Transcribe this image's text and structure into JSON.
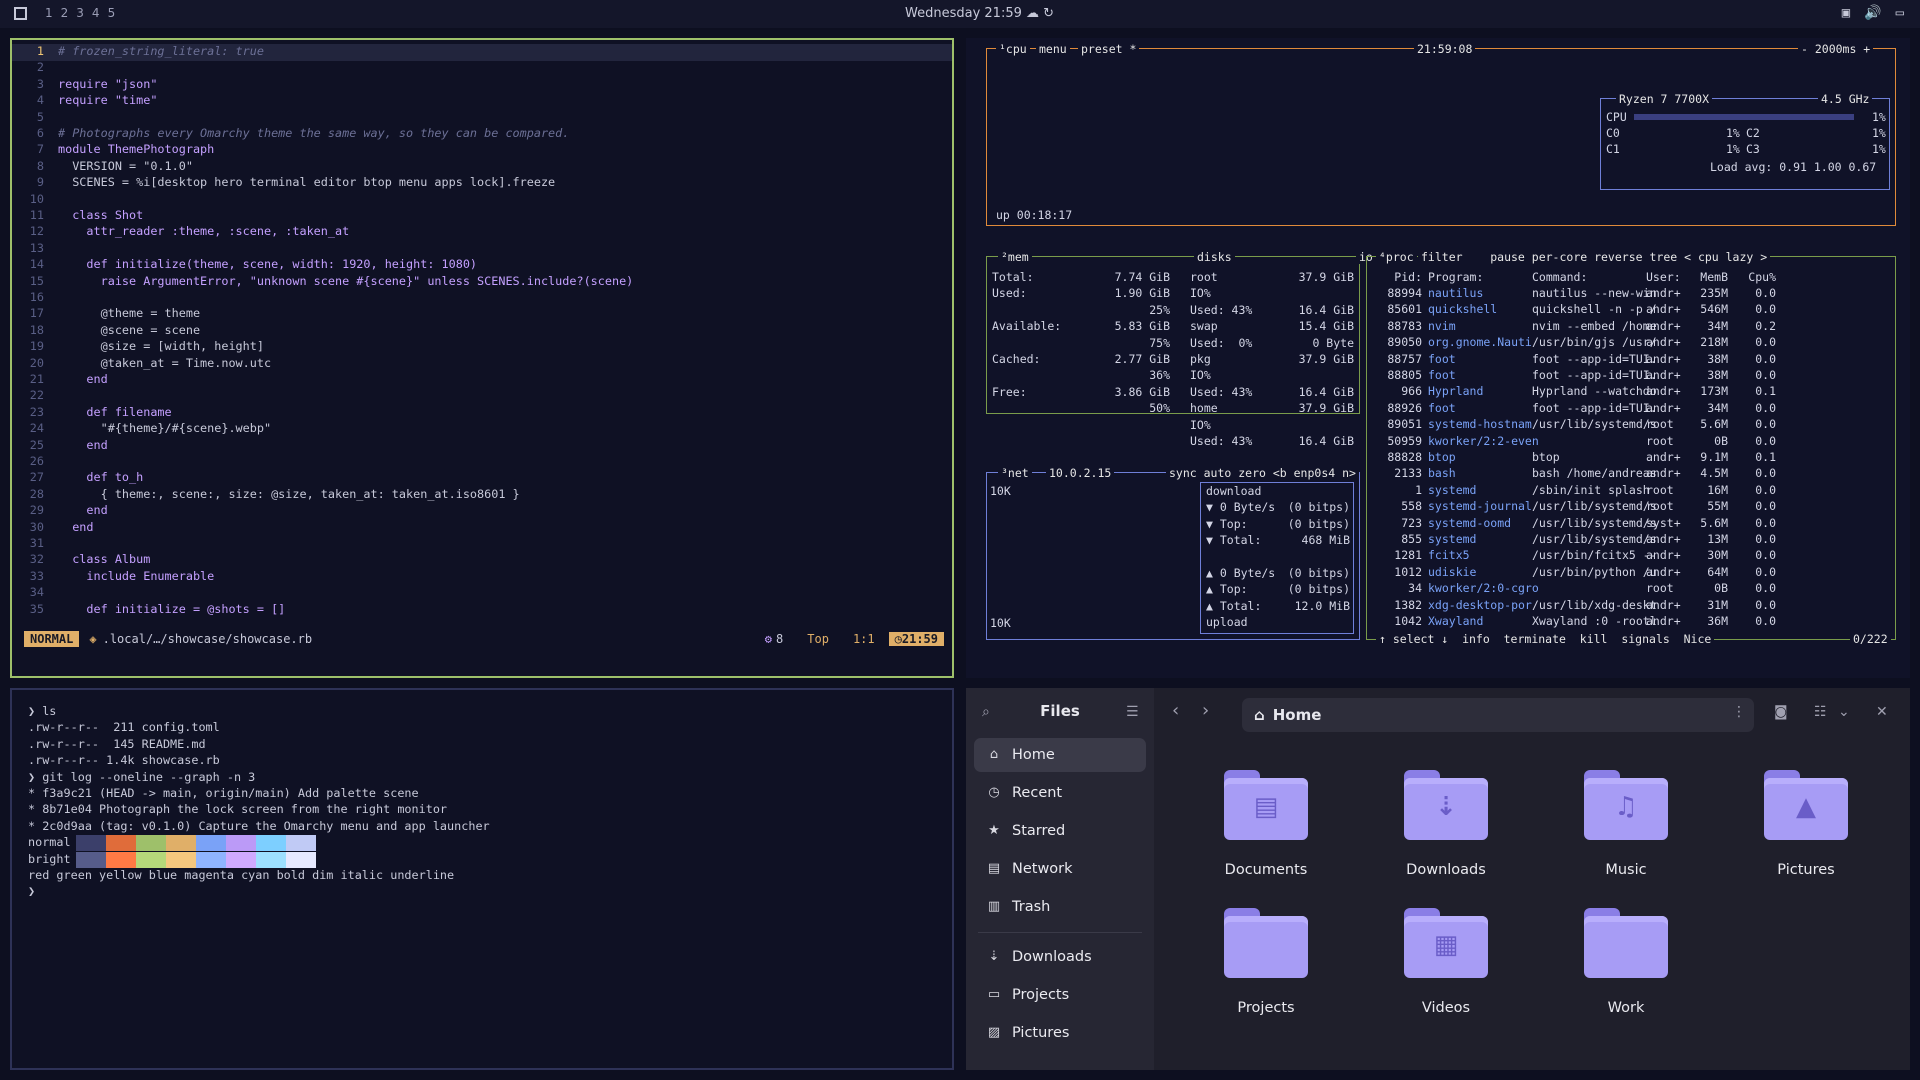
{
  "topbar": {
    "workspaces": [
      "1",
      "2",
      "3",
      "4",
      "5"
    ],
    "clock": "Wednesday 21:59",
    "icons": [
      "cloud-sync-icon",
      "refresh-icon"
    ],
    "tray": [
      "screen-icon",
      "volume-icon",
      "display-icon"
    ]
  },
  "nvim": {
    "lines": [
      [
        "1",
        "# frozen_string_literal: true"
      ],
      [
        "2",
        ""
      ],
      [
        "3",
        "require \"json\""
      ],
      [
        "4",
        "require \"time\""
      ],
      [
        "5",
        ""
      ],
      [
        "6",
        "# Photographs every Omarchy theme the same way, so they can be compared."
      ],
      [
        "7",
        "module ThemePhotograph"
      ],
      [
        "8",
        "  VERSION = \"0.1.0\""
      ],
      [
        "9",
        "  SCENES = %i[desktop hero terminal editor btop menu apps lock].freeze"
      ],
      [
        "10",
        ""
      ],
      [
        "11",
        "  class Shot"
      ],
      [
        "12",
        "    attr_reader :theme, :scene, :taken_at"
      ],
      [
        "13",
        ""
      ],
      [
        "14",
        "    def initialize(theme, scene, width: 1920, height: 1080)"
      ],
      [
        "15",
        "      raise ArgumentError, \"unknown scene #{scene}\" unless SCENES.include?(scene)"
      ],
      [
        "16",
        ""
      ],
      [
        "17",
        "      @theme = theme"
      ],
      [
        "18",
        "      @scene = scene"
      ],
      [
        "19",
        "      @size = [width, height]"
      ],
      [
        "20",
        "      @taken_at = Time.now.utc"
      ],
      [
        "21",
        "    end"
      ],
      [
        "22",
        ""
      ],
      [
        "23",
        "    def filename"
      ],
      [
        "24",
        "      \"#{theme}/#{scene}.webp\""
      ],
      [
        "25",
        "    end"
      ],
      [
        "26",
        ""
      ],
      [
        "27",
        "    def to_h"
      ],
      [
        "28",
        "      { theme:, scene:, size: @size, taken_at: taken_at.iso8601 }"
      ],
      [
        "29",
        "    end"
      ],
      [
        "30",
        "  end"
      ],
      [
        "31",
        ""
      ],
      [
        "32",
        "  class Album"
      ],
      [
        "33",
        "    include Enumerable"
      ],
      [
        "34",
        ""
      ],
      [
        "35",
        "    def initialize = @shots = []"
      ]
    ],
    "status": {
      "mode": "NORMAL",
      "file": ".local/…/showcase/showcase.rb",
      "lsp": "8",
      "pos": "Top",
      "cursor": "1:1",
      "time": "21:59"
    }
  },
  "btop": {
    "cpu": {
      "label": "¹cpu",
      "menu": "menu",
      "preset": "preset *",
      "time": "21:59:08",
      "interval": "- 2000ms +",
      "uptime": "up 00:18:17",
      "model": "Ryzen 7 7700X",
      "freq": "4.5 GHz",
      "rows": [
        "CPU",
        "C0",
        "C1"
      ],
      "rows2": [
        "C2",
        "C3"
      ],
      "pct": "1%",
      "load": "Load avg: 0.91 1.00 0.67"
    },
    "mem": {
      "label": "²mem",
      "rows": [
        [
          "Total:",
          "7.74 GiB"
        ],
        [
          "Used:",
          "1.90 GiB"
        ],
        [
          "",
          "25%"
        ],
        [
          "Available:",
          "5.83 GiB"
        ],
        [
          "",
          "75%"
        ],
        [
          "Cached:",
          "2.77 GiB"
        ],
        [
          "",
          "36%"
        ],
        [
          "Free:",
          "3.86 GiB"
        ],
        [
          "",
          "50%"
        ]
      ]
    },
    "disks": {
      "label": "disks",
      "io": "io",
      "rows": [
        [
          "root",
          "37.9 GiB"
        ],
        [
          "IO%",
          ""
        ],
        [
          "Used: 43%",
          "16.4 GiB"
        ],
        [
          "swap",
          "15.4 GiB"
        ],
        [
          "Used:  0%",
          "0 Byte"
        ],
        [
          "pkg",
          "37.9 GiB"
        ],
        [
          "IO%",
          ""
        ],
        [
          "Used: 43%",
          "16.4 GiB"
        ],
        [
          "home",
          "37.9 GiB"
        ],
        [
          "IO%",
          ""
        ],
        [
          "Used: 43%",
          "16.4 GiB"
        ]
      ]
    },
    "net": {
      "label": "³net",
      "ip": "10.0.2.15",
      "opts": "sync auto zero <b enp0s4 n>",
      "scale_top": "10K",
      "scale_bot": "10K",
      "rows": [
        [
          "download",
          ""
        ],
        [
          "▼ 0 Byte/s",
          "(0 bitps)"
        ],
        [
          "▼ Top:",
          "(0 bitps)"
        ],
        [
          "▼ Total:",
          "468 MiB"
        ],
        [
          "",
          ""
        ],
        [
          "▲ 0 Byte/s",
          "(0 bitps)"
        ],
        [
          "▲ Top:",
          "(0 bitps)"
        ],
        [
          "▲ Total:",
          "12.0 MiB"
        ],
        [
          "upload",
          ""
        ]
      ]
    },
    "proc": {
      "label": "⁴proc",
      "opts": "filter    pause per-core reverse tree < cpu lazy >",
      "header": [
        "Pid:",
        "Program:",
        "Command:",
        "User:",
        "MemB",
        "Cpu%"
      ],
      "rows": [
        [
          "88994",
          "nautilus",
          "nautilus --new-win",
          "andr+",
          "235M",
          "0.0"
        ],
        [
          "85601",
          "quickshell",
          "quickshell -n -p /",
          "andr+",
          "546M",
          "0.0"
        ],
        [
          "88783",
          "nvim",
          "nvim --embed /home",
          "andr+",
          "34M",
          "0.2"
        ],
        [
          "89050",
          "org.gnome.Nauti",
          "/usr/bin/gjs /usr/",
          "andr+",
          "218M",
          "0.0"
        ],
        [
          "88757",
          "foot",
          "foot --app-id=TUI.",
          "andr+",
          "38M",
          "0.0"
        ],
        [
          "88805",
          "foot",
          "foot --app-id=TUI.",
          "andr+",
          "38M",
          "0.0"
        ],
        [
          "966",
          "Hyprland",
          "Hyprland --watchdo",
          "andr+",
          "173M",
          "0.1"
        ],
        [
          "88926",
          "foot",
          "foot --app-id=TUI.",
          "andr+",
          "34M",
          "0.0"
        ],
        [
          "89051",
          "systemd-hostnam",
          "/usr/lib/systemd/s",
          "root",
          "5.6M",
          "0.0"
        ],
        [
          "50959",
          "kworker/2:2-even",
          "",
          "root",
          "0B",
          "0.0"
        ],
        [
          "88828",
          "btop",
          "btop",
          "andr+",
          "9.1M",
          "0.1"
        ],
        [
          "2133",
          "bash",
          "bash /home/andreas",
          "andr+",
          "4.5M",
          "0.0"
        ],
        [
          "1",
          "systemd",
          "/sbin/init splash",
          "root",
          "16M",
          "0.0"
        ],
        [
          "558",
          "systemd-journal",
          "/usr/lib/systemd/s",
          "root",
          "55M",
          "0.0"
        ],
        [
          "723",
          "systemd-oomd",
          "/usr/lib/systemd/s",
          "syst+",
          "5.6M",
          "0.0"
        ],
        [
          "855",
          "systemd",
          "/usr/lib/systemd/s",
          "andr+",
          "13M",
          "0.0"
        ],
        [
          "1281",
          "fcitx5",
          "/usr/bin/fcitx5 --",
          "andr+",
          "30M",
          "0.0"
        ],
        [
          "1012",
          "udiskie",
          "/usr/bin/python /u",
          "andr+",
          "64M",
          "0.0"
        ],
        [
          "34",
          "kworker/2:0-cgro",
          "",
          "root",
          "0B",
          "0.0"
        ],
        [
          "1382",
          "xdg-desktop-por",
          "/usr/lib/xdg-deskt",
          "andr+",
          "31M",
          "0.0"
        ],
        [
          "1042",
          "Xwayland",
          "Xwayland :0 -rootl",
          "andr+",
          "36M",
          "0.0"
        ]
      ],
      "footer": "↑ select ↓  info  terminate  kill  signals  Nice",
      "count": "0/222"
    }
  },
  "terminal": {
    "lines": [
      "❯ ls",
      ".rw-r--r--  211 config.toml",
      ".rw-r--r--  145 README.md",
      ".rw-r--r-- 1.4k showcase.rb",
      "❯ git log --oneline --graph -n 3",
      "* f3a9c21 (HEAD -> main, origin/main) Add palette scene",
      "* 8b71e04 Photograph the lock screen from the right monitor",
      "* 2c0d9aa (tag: v0.1.0) Capture the Omarchy menu and app launcher",
      "normal",
      "bright",
      "red green yellow blue magenta cyan bold dim italic underline",
      "❯"
    ],
    "palette_normal": [
      "#3b3f6a",
      "#e06c3a",
      "#9ec06a",
      "#e0af68",
      "#7aa2f7",
      "#bb9af7",
      "#7dcfff",
      "#c0caf5"
    ],
    "palette_bright": [
      "#565c8a",
      "#ff7a45",
      "#b5d87a",
      "#f5c77e",
      "#8fb4ff",
      "#cfaaff",
      "#9de0ff",
      "#e6e9ff"
    ]
  },
  "files": {
    "title": "Files",
    "sidebar": [
      {
        "label": "Home",
        "icon": "home-icon"
      },
      {
        "label": "Recent",
        "icon": "clock-icon"
      },
      {
        "label": "Starred",
        "icon": "star-icon"
      },
      {
        "label": "Network",
        "icon": "network-icon"
      },
      {
        "label": "Trash",
        "icon": "trash-icon"
      },
      {
        "label": "Downloads",
        "icon": "download-icon"
      },
      {
        "label": "Projects",
        "icon": "folder-icon"
      },
      {
        "label": "Pictures",
        "icon": "image-icon"
      }
    ],
    "path": "Home",
    "folders": [
      {
        "name": "Documents",
        "icon": "document-icon"
      },
      {
        "name": "Downloads",
        "icon": "download-icon"
      },
      {
        "name": "Music",
        "icon": "music-icon"
      },
      {
        "name": "Pictures",
        "icon": "image-icon"
      },
      {
        "name": "Projects",
        "icon": "folder-icon"
      },
      {
        "name": "Videos",
        "icon": "film-icon"
      },
      {
        "name": "Work",
        "icon": "folder-icon"
      }
    ]
  }
}
